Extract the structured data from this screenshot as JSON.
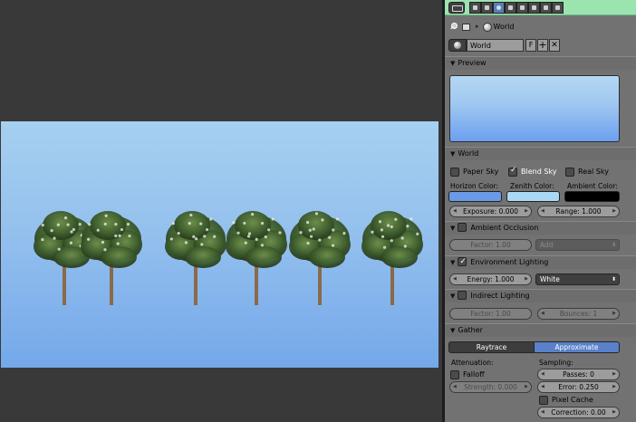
{
  "viewport": {
    "render_name": "rendered-tree-row"
  },
  "header": {
    "editor_type_icon": "editor-type-icon",
    "tabs": [
      "render-tab",
      "scene-tab",
      "world-tab",
      "object-tab",
      "constraints-tab",
      "modifiers-tab",
      "material-tab",
      "texture-tab"
    ],
    "active_tab": "world-tab"
  },
  "breadcrumb": {
    "pin_icon": "pin-icon",
    "scene_icon": "scene-icon",
    "world_icon": "world-icon",
    "label": "World"
  },
  "datablock": {
    "name": "World",
    "fake_user": "F",
    "add": "+",
    "unlink": "✕"
  },
  "sections": {
    "preview": {
      "title": "Preview"
    },
    "world": {
      "title": "World",
      "paper_sky": "Paper Sky",
      "blend_sky": "Blend Sky",
      "real_sky": "Real Sky",
      "horizon_label": "Horizon Color:",
      "zenith_label": "Zenith Color:",
      "ambient_label": "Ambient Color:",
      "horizon_color": "#6a99e6",
      "zenith_color": "#a9d7f4",
      "ambient_color": "#000000",
      "exposure": "Exposure: 0.000",
      "range": "Range: 1.000"
    },
    "ambient_occlusion": {
      "title": "Ambient Occlusion",
      "factor": "Factor: 1.00",
      "blend_mode": "Add"
    },
    "environment_lighting": {
      "title": "Environment Lighting",
      "energy": "Energy: 1.000",
      "color_mode": "White"
    },
    "indirect_lighting": {
      "title": "Indirect Lighting",
      "factor": "Factor: 1.00",
      "bounces": "Bounces: 1"
    },
    "gather": {
      "title": "Gather",
      "raytrace": "Raytrace",
      "approximate": "Approximate",
      "attenuation_label": "Attenuation:",
      "sampling_label": "Sampling:",
      "falloff": "Falloff",
      "strength": "Strength: 0.000",
      "passes": "Passes: 0",
      "error": "Error: 0.250",
      "pixel_cache": "Pixel Cache",
      "correction": "Correction: 0.00"
    }
  }
}
